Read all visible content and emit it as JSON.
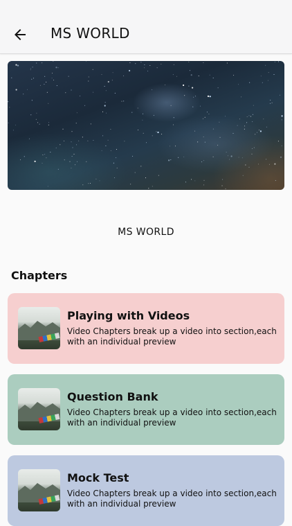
{
  "appbar": {
    "title": "MS WORLD"
  },
  "hero": {
    "caption": "MS WORLD"
  },
  "chapters": {
    "heading": "Chapters",
    "items": [
      {
        "title": "Playing with Videos",
        "description": "Video Chapters break up a video into section,each with an individual preview",
        "color": "#f6cfcf"
      },
      {
        "title": "Question Bank",
        "description": "Video Chapters break up a video into section,each with an individual preview",
        "color": "#abcdbf"
      },
      {
        "title": "Mock Test",
        "description": "Video Chapters break up a video into section,each with an individual preview",
        "color": "#bdc9e0"
      }
    ]
  }
}
